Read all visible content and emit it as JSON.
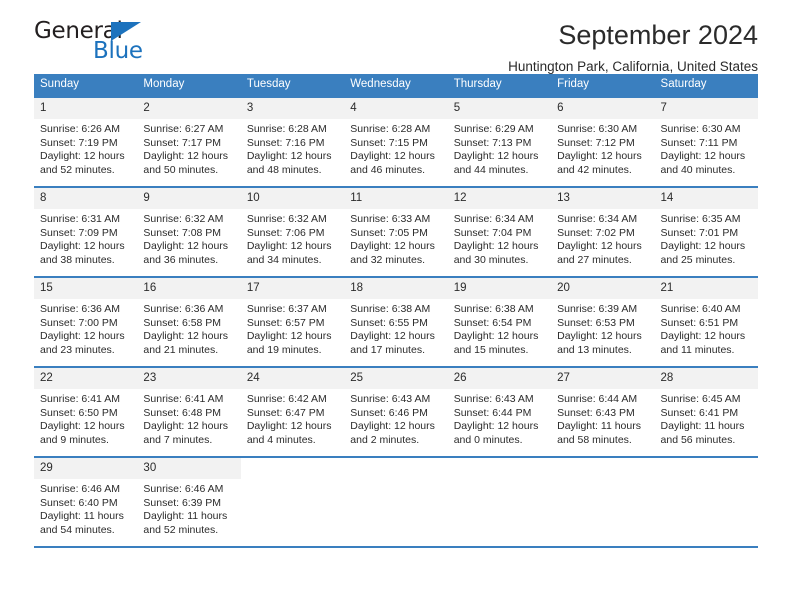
{
  "logo": {
    "word_top": "General",
    "word_bottom": "Blue",
    "triangle_color": "#1c72bd",
    "text_color": "#231f20"
  },
  "header": {
    "title": "September 2024",
    "subtitle": "Huntington Park, California, United States"
  },
  "theme": {
    "header_blue": "#3a7fbf",
    "daynum_band": "#f2f2f2",
    "text": "#2b2b2b"
  },
  "weekday_headers": [
    "Sunday",
    "Monday",
    "Tuesday",
    "Wednesday",
    "Thursday",
    "Friday",
    "Saturday"
  ],
  "weeks": [
    [
      {
        "day": "1",
        "sunrise": "Sunrise: 6:26 AM",
        "sunset": "Sunset: 7:19 PM",
        "daylight": "Daylight: 12 hours and 52 minutes."
      },
      {
        "day": "2",
        "sunrise": "Sunrise: 6:27 AM",
        "sunset": "Sunset: 7:17 PM",
        "daylight": "Daylight: 12 hours and 50 minutes."
      },
      {
        "day": "3",
        "sunrise": "Sunrise: 6:28 AM",
        "sunset": "Sunset: 7:16 PM",
        "daylight": "Daylight: 12 hours and 48 minutes."
      },
      {
        "day": "4",
        "sunrise": "Sunrise: 6:28 AM",
        "sunset": "Sunset: 7:15 PM",
        "daylight": "Daylight: 12 hours and 46 minutes."
      },
      {
        "day": "5",
        "sunrise": "Sunrise: 6:29 AM",
        "sunset": "Sunset: 7:13 PM",
        "daylight": "Daylight: 12 hours and 44 minutes."
      },
      {
        "day": "6",
        "sunrise": "Sunrise: 6:30 AM",
        "sunset": "Sunset: 7:12 PM",
        "daylight": "Daylight: 12 hours and 42 minutes."
      },
      {
        "day": "7",
        "sunrise": "Sunrise: 6:30 AM",
        "sunset": "Sunset: 7:11 PM",
        "daylight": "Daylight: 12 hours and 40 minutes."
      }
    ],
    [
      {
        "day": "8",
        "sunrise": "Sunrise: 6:31 AM",
        "sunset": "Sunset: 7:09 PM",
        "daylight": "Daylight: 12 hours and 38 minutes."
      },
      {
        "day": "9",
        "sunrise": "Sunrise: 6:32 AM",
        "sunset": "Sunset: 7:08 PM",
        "daylight": "Daylight: 12 hours and 36 minutes."
      },
      {
        "day": "10",
        "sunrise": "Sunrise: 6:32 AM",
        "sunset": "Sunset: 7:06 PM",
        "daylight": "Daylight: 12 hours and 34 minutes."
      },
      {
        "day": "11",
        "sunrise": "Sunrise: 6:33 AM",
        "sunset": "Sunset: 7:05 PM",
        "daylight": "Daylight: 12 hours and 32 minutes."
      },
      {
        "day": "12",
        "sunrise": "Sunrise: 6:34 AM",
        "sunset": "Sunset: 7:04 PM",
        "daylight": "Daylight: 12 hours and 30 minutes."
      },
      {
        "day": "13",
        "sunrise": "Sunrise: 6:34 AM",
        "sunset": "Sunset: 7:02 PM",
        "daylight": "Daylight: 12 hours and 27 minutes."
      },
      {
        "day": "14",
        "sunrise": "Sunrise: 6:35 AM",
        "sunset": "Sunset: 7:01 PM",
        "daylight": "Daylight: 12 hours and 25 minutes."
      }
    ],
    [
      {
        "day": "15",
        "sunrise": "Sunrise: 6:36 AM",
        "sunset": "Sunset: 7:00 PM",
        "daylight": "Daylight: 12 hours and 23 minutes."
      },
      {
        "day": "16",
        "sunrise": "Sunrise: 6:36 AM",
        "sunset": "Sunset: 6:58 PM",
        "daylight": "Daylight: 12 hours and 21 minutes."
      },
      {
        "day": "17",
        "sunrise": "Sunrise: 6:37 AM",
        "sunset": "Sunset: 6:57 PM",
        "daylight": "Daylight: 12 hours and 19 minutes."
      },
      {
        "day": "18",
        "sunrise": "Sunrise: 6:38 AM",
        "sunset": "Sunset: 6:55 PM",
        "daylight": "Daylight: 12 hours and 17 minutes."
      },
      {
        "day": "19",
        "sunrise": "Sunrise: 6:38 AM",
        "sunset": "Sunset: 6:54 PM",
        "daylight": "Daylight: 12 hours and 15 minutes."
      },
      {
        "day": "20",
        "sunrise": "Sunrise: 6:39 AM",
        "sunset": "Sunset: 6:53 PM",
        "daylight": "Daylight: 12 hours and 13 minutes."
      },
      {
        "day": "21",
        "sunrise": "Sunrise: 6:40 AM",
        "sunset": "Sunset: 6:51 PM",
        "daylight": "Daylight: 12 hours and 11 minutes."
      }
    ],
    [
      {
        "day": "22",
        "sunrise": "Sunrise: 6:41 AM",
        "sunset": "Sunset: 6:50 PM",
        "daylight": "Daylight: 12 hours and 9 minutes."
      },
      {
        "day": "23",
        "sunrise": "Sunrise: 6:41 AM",
        "sunset": "Sunset: 6:48 PM",
        "daylight": "Daylight: 12 hours and 7 minutes."
      },
      {
        "day": "24",
        "sunrise": "Sunrise: 6:42 AM",
        "sunset": "Sunset: 6:47 PM",
        "daylight": "Daylight: 12 hours and 4 minutes."
      },
      {
        "day": "25",
        "sunrise": "Sunrise: 6:43 AM",
        "sunset": "Sunset: 6:46 PM",
        "daylight": "Daylight: 12 hours and 2 minutes."
      },
      {
        "day": "26",
        "sunrise": "Sunrise: 6:43 AM",
        "sunset": "Sunset: 6:44 PM",
        "daylight": "Daylight: 12 hours and 0 minutes."
      },
      {
        "day": "27",
        "sunrise": "Sunrise: 6:44 AM",
        "sunset": "Sunset: 6:43 PM",
        "daylight": "Daylight: 11 hours and 58 minutes."
      },
      {
        "day": "28",
        "sunrise": "Sunrise: 6:45 AM",
        "sunset": "Sunset: 6:41 PM",
        "daylight": "Daylight: 11 hours and 56 minutes."
      }
    ],
    [
      {
        "day": "29",
        "sunrise": "Sunrise: 6:46 AM",
        "sunset": "Sunset: 6:40 PM",
        "daylight": "Daylight: 11 hours and 54 minutes."
      },
      {
        "day": "30",
        "sunrise": "Sunrise: 6:46 AM",
        "sunset": "Sunset: 6:39 PM",
        "daylight": "Daylight: 11 hours and 52 minutes."
      },
      {
        "day": "",
        "sunrise": "",
        "sunset": "",
        "daylight": ""
      },
      {
        "day": "",
        "sunrise": "",
        "sunset": "",
        "daylight": ""
      },
      {
        "day": "",
        "sunrise": "",
        "sunset": "",
        "daylight": ""
      },
      {
        "day": "",
        "sunrise": "",
        "sunset": "",
        "daylight": ""
      },
      {
        "day": "",
        "sunrise": "",
        "sunset": "",
        "daylight": ""
      }
    ]
  ]
}
